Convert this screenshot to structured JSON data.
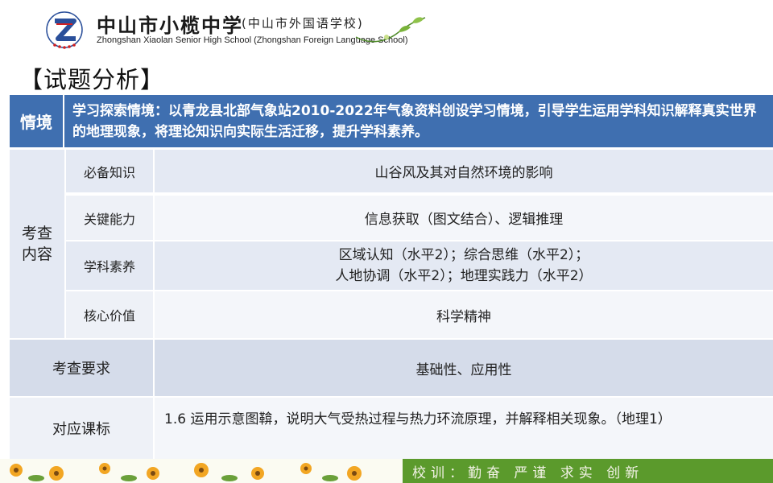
{
  "school": {
    "name_cn": "中山市小榄中学",
    "name_cn_sub": "(中山市外国语学校)",
    "name_en": "Zhongshan Xiaolan Senior High School  (Zhongshan Foreign Language School)",
    "logo_ring_text": "XIAOLANZHONGXUE"
  },
  "section_title": "【试题分析】",
  "table": {
    "situation_label": "情境",
    "situation_text": "学习探索情境：以青龙县北部气象站2010-2022年气象资料创设学习情境，引导学生运用学科知识解释真实世界的地理现象，将理论知识向实际生活迁移，提升学科素养。",
    "exam_content_label": "考查\n内容",
    "rows": [
      {
        "label": "必备知识",
        "value": "山谷风及其对自然环境的影响"
      },
      {
        "label": "关键能力",
        "value": "信息获取（图文结合）、逻辑推理"
      },
      {
        "label": "学科素养",
        "value_line1": "区域认知（水平2）；综合思维（水平2）；",
        "value_line2": "人地协调（水平2）；地理实践力（水平2）"
      },
      {
        "label": "核心价值",
        "value": "科学精神"
      }
    ],
    "requirement_label": "考查要求",
    "requirement_value": "基础性、应用性",
    "standard_label": "对应课标",
    "standard_value": "1.6 运用示意图鞥，说明大气受热过程与热力环流原理，并解释相关现象。（地理1）"
  },
  "footer": {
    "motto": "校训：勤奋  严谨  求实  创新"
  },
  "colors": {
    "header_blue": "#3f6fb0",
    "row_light": "#e4e9f3",
    "footer_green": "#5b9a2c"
  }
}
